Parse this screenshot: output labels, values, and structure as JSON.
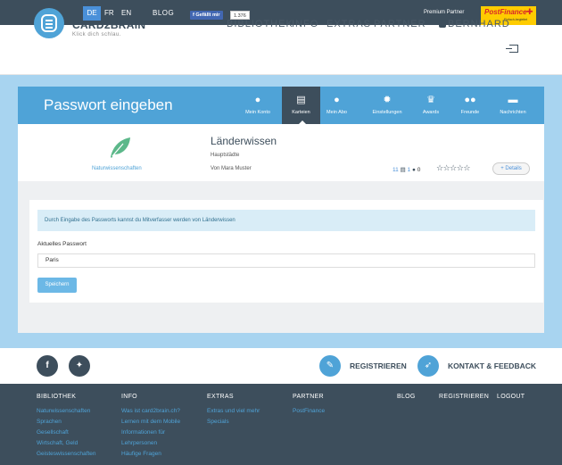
{
  "topbar": {
    "languages": [
      "DE",
      "FR",
      "EN"
    ],
    "active_language": "DE",
    "blog": "BLOG",
    "fb_like": "Gefällt mir",
    "fb_count": "1.376",
    "premium_partner": "Premium Partner",
    "postfinance_logo": "PostFinance",
    "postfinance_sub": "Einfach-begleitet"
  },
  "header": {
    "logo_title": "CARD2BRAIN",
    "logo_tagline": "Klick dich schlau.",
    "nav": [
      "BIBLIOTHEK",
      "INFO",
      "EXTRAS",
      "PARTNER"
    ],
    "user": "BERNHARD"
  },
  "tabbar": {
    "title": "Passwort eingeben",
    "tabs": [
      {
        "label": "Mein Konto",
        "icon": "user-icon"
      },
      {
        "label": "Karteien",
        "icon": "cards-icon"
      },
      {
        "label": "Mein Abo",
        "icon": "subscription-icon"
      },
      {
        "label": "Einstellungen",
        "icon": "gear-icon"
      },
      {
        "label": "Awards",
        "icon": "trophy-icon"
      },
      {
        "label": "Freunde",
        "icon": "friends-icon"
      },
      {
        "label": "Nachrichten",
        "icon": "chat-icon"
      }
    ],
    "active_tab": "Karteien"
  },
  "card": {
    "category": "Naturwissenschaften",
    "title": "Länderwissen",
    "subtitle": "Hauptstädte",
    "author": "Von  Mara Muster",
    "cards_count": "11",
    "users_count": "1",
    "rating_count": "0",
    "details_label": "+ Details"
  },
  "form": {
    "info_text": "Durch Eingabe des Passworts kannst du Mitverfasser werden von Länderwissen",
    "password_label": "Aktuelles Passwort",
    "password_value": "Paris",
    "save_label": "Speichern"
  },
  "social": {
    "facebook": "f",
    "register_label": "REGISTRIEREN",
    "contact_label": "KONTAKT & FEEDBACK"
  },
  "footer": {
    "columns": [
      {
        "heading": "BIBLIOTHEK",
        "links": [
          "Naturwissenschaften",
          "Sprachen",
          "Gesellschaft",
          "Wirtschaft, Geld",
          "Geisteswissenschaften"
        ]
      },
      {
        "heading": "INFO",
        "links": [
          "Was ist card2brain.ch?",
          "Lernen mit dem Mobile",
          "Informationen für",
          "Lehrpersonen",
          "Häufige Fragen"
        ]
      },
      {
        "heading": "EXTRAS",
        "links": [
          "Extras und viel mehr",
          "Specials"
        ]
      },
      {
        "heading": "PARTNER",
        "links": [
          "PostFinance"
        ]
      }
    ],
    "right_links": [
      "BLOG",
      "REGISTRIEREN",
      "LOGOUT"
    ]
  },
  "colors": {
    "dark": "#3d4e5c",
    "accent_blue": "#4fa3d7",
    "band": "#a8d4f0",
    "postfinance_yellow": "#ffcc00"
  }
}
